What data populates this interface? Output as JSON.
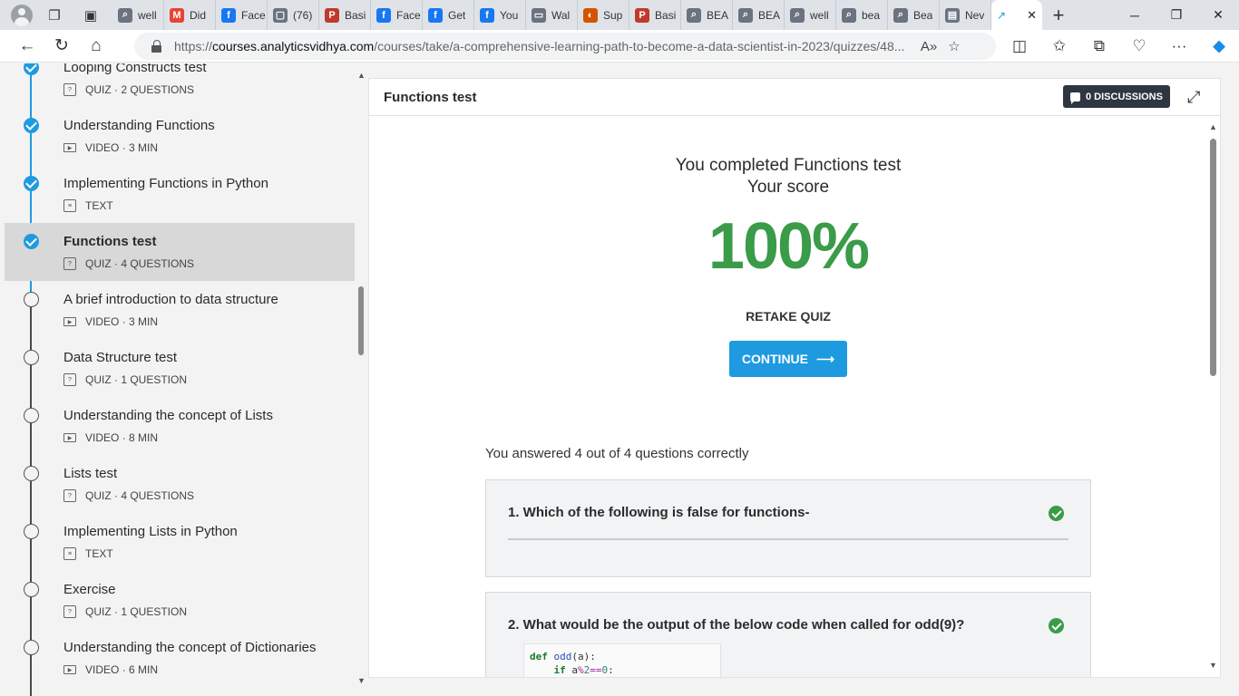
{
  "browser": {
    "tabs": [
      {
        "title": "well",
        "icon": "search-icon",
        "color": "#6b7280"
      },
      {
        "title": "Did",
        "icon": "gmail-icon",
        "color": "#ea4335"
      },
      {
        "title": "Face",
        "icon": "facebook-icon",
        "color": "#1877f2"
      },
      {
        "title": "(76)",
        "icon": "page-icon",
        "color": "#6b7280"
      },
      {
        "title": "Basi",
        "icon": "pdf-icon",
        "color": "#c0392b"
      },
      {
        "title": "Face",
        "icon": "facebook-icon",
        "color": "#1877f2"
      },
      {
        "title": "Get",
        "icon": "facebook-icon",
        "color": "#1877f2"
      },
      {
        "title": "You",
        "icon": "facebook-icon",
        "color": "#1877f2"
      },
      {
        "title": "Wal",
        "icon": "briefcase-icon",
        "color": "#6b7280"
      },
      {
        "title": "Sup",
        "icon": "app-icon",
        "color": "#d35400"
      },
      {
        "title": "Basi",
        "icon": "pdf-icon",
        "color": "#c0392b"
      },
      {
        "title": "BEA",
        "icon": "search-icon",
        "color": "#6b7280"
      },
      {
        "title": "BEA",
        "icon": "search-icon",
        "color": "#6b7280"
      },
      {
        "title": "well",
        "icon": "search-icon",
        "color": "#6b7280"
      },
      {
        "title": "bea",
        "icon": "search-icon",
        "color": "#6b7280"
      },
      {
        "title": "Bea",
        "icon": "search-icon",
        "color": "#6b7280"
      },
      {
        "title": "Nev",
        "icon": "newtab-icon",
        "color": "#6b7280"
      }
    ],
    "url_prefix": "https://",
    "url_host": "courses.analyticsvidhya.com",
    "url_path": "/courses/take/a-comprehensive-learning-path-to-become-a-data-scientist-in-2023/quizzes/48..."
  },
  "sidebar": {
    "items": [
      {
        "title": "Looping Constructs test",
        "meta": "QUIZ · 2 QUESTIONS",
        "type": "quiz",
        "status": "done"
      },
      {
        "title": "Understanding Functions",
        "meta": "VIDEO · 3 MIN",
        "type": "video",
        "status": "done"
      },
      {
        "title": "Implementing Functions in Python",
        "meta": "TEXT",
        "type": "text",
        "status": "done"
      },
      {
        "title": "Functions test",
        "meta": "QUIZ · 4 QUESTIONS",
        "type": "quiz",
        "status": "current"
      },
      {
        "title": "A brief introduction to data structure",
        "meta": "VIDEO · 3 MIN",
        "type": "video",
        "status": "todo"
      },
      {
        "title": "Data Structure test",
        "meta": "QUIZ · 1 QUESTION",
        "type": "quiz",
        "status": "todo"
      },
      {
        "title": "Understanding the concept of Lists",
        "meta": "VIDEO · 8 MIN",
        "type": "video",
        "status": "todo"
      },
      {
        "title": "Lists test",
        "meta": "QUIZ · 4 QUESTIONS",
        "type": "quiz",
        "status": "todo"
      },
      {
        "title": "Implementing Lists in Python",
        "meta": "TEXT",
        "type": "text",
        "status": "todo"
      },
      {
        "title": "Exercise",
        "meta": "QUIZ · 1 QUESTION",
        "type": "quiz",
        "status": "todo"
      },
      {
        "title": "Understanding the concept of Dictionaries",
        "meta": "VIDEO · 6 MIN",
        "type": "video",
        "status": "todo"
      }
    ]
  },
  "main": {
    "title": "Functions test",
    "discussions_label": "0 DISCUSSIONS",
    "completed_line": "You completed Functions test",
    "score_label": "Your score",
    "score": "100%",
    "retake_label": "RETAKE QUIZ",
    "continue_label": "CONTINUE",
    "answered_text": "You answered 4 out of 4 questions correctly",
    "questions": [
      {
        "text": "1. Which of the following is false for functions-",
        "correct": true
      },
      {
        "text": "2. What would be the output of the below code when called for odd(9)?",
        "correct": true
      }
    ],
    "code_line1": "def odd(a):",
    "code_line2": "    if a%2==0:"
  },
  "colors": {
    "accent": "#1e9ae0",
    "success": "#3a9b48",
    "dark_button": "#2e3641"
  }
}
